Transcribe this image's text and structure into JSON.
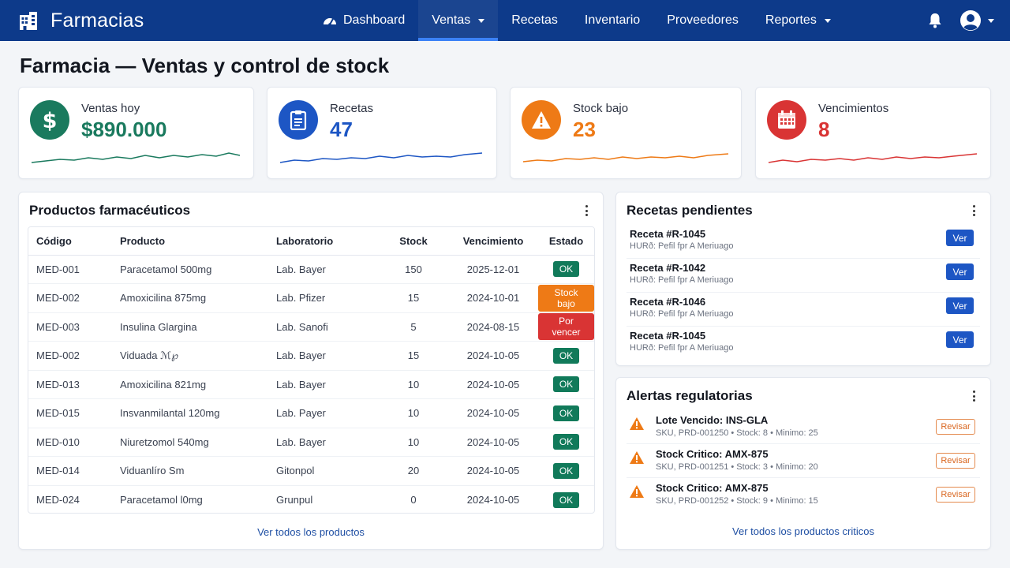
{
  "app": {
    "title": "Farmacias"
  },
  "nav": {
    "items": [
      {
        "label": "Dashboard",
        "icon": "gauge-icon"
      },
      {
        "label": "Ventas",
        "dropdown": true,
        "active": true
      },
      {
        "label": "Recetas"
      },
      {
        "label": "Inventario"
      },
      {
        "label": "Proveedores"
      },
      {
        "label": "Reportes",
        "dropdown": true
      }
    ]
  },
  "page": {
    "title": "Farmacia — Ventas y control de stock"
  },
  "kpis": [
    {
      "label": "Ventas hoy",
      "value": "$890.000",
      "icon": "dollar-icon",
      "color": "#1a7a5e"
    },
    {
      "label": "Recetas",
      "value": "47",
      "icon": "clipboard-icon",
      "color": "#1d56c4"
    },
    {
      "label": "Stock bajo",
      "value": "23",
      "icon": "warning-icon",
      "color": "#ee7a16"
    },
    {
      "label": "Vencimientos",
      "value": "8",
      "icon": "calendar-icon",
      "color": "#d93434"
    }
  ],
  "products": {
    "title": "Productos farmacéuticos",
    "columns": [
      "Código",
      "Producto",
      "Laboratorio",
      "Stock",
      "Vencimiento",
      "Estado"
    ],
    "rows": [
      {
        "code": "MED-001",
        "product": "Paracetamol 500mg",
        "lab": "Lab. Bayer",
        "stock": "150",
        "expiry": "2025-12-01",
        "status": "OK",
        "status_color": "#117a5a"
      },
      {
        "code": "MED-002",
        "product": "Amoxicilina 875mg",
        "lab": "Lab. Pfizer",
        "stock": "15",
        "expiry": "2024-10-01",
        "status": "Stock bajo",
        "status_color": "#ee7a16"
      },
      {
        "code": "MED-003",
        "product": "Insulina Glargina",
        "lab": "Lab. Sanofi",
        "stock": "5",
        "expiry": "2024-08-15",
        "status": "Por vencer",
        "status_color": "#d93434"
      },
      {
        "code": "MED-002",
        "product": "Viduada ℳ℘",
        "lab": "Lab. Bayer",
        "stock": "15",
        "expiry": "2024-10-05",
        "status": "OK",
        "status_color": "#117a5a"
      },
      {
        "code": "MED-013",
        "product": "Amoxicilina 821mg",
        "lab": "Lab. Bayer",
        "stock": "10",
        "expiry": "2024-10-05",
        "status": "OK",
        "status_color": "#117a5a"
      },
      {
        "code": "MED-015",
        "product": "Insvanmilantal 120mg",
        "lab": "Lab. Payer",
        "stock": "10",
        "expiry": "2024-10-05",
        "status": "OK",
        "status_color": "#117a5a"
      },
      {
        "code": "MED-010",
        "product": "Niuretzomol 540mg",
        "lab": "Lab. Bayer",
        "stock": "10",
        "expiry": "2024-10-05",
        "status": "OK",
        "status_color": "#117a5a"
      },
      {
        "code": "MED-014",
        "product": "Viduanlíro Sm",
        "lab": "Gitonpol",
        "stock": "20",
        "expiry": "2024-10-05",
        "status": "OK",
        "status_color": "#117a5a"
      },
      {
        "code": "MED-024",
        "product": "Paracetamol l0mg",
        "lab": "Grunpul",
        "stock": "0",
        "expiry": "2024-10-05",
        "status": "OK",
        "status_color": "#117a5a"
      }
    ],
    "footer_link": "Ver todos los productos"
  },
  "prescriptions": {
    "title": "Recetas pendientes",
    "button_label": "Ver",
    "items": [
      {
        "title": "Receta #R-1045",
        "subtitle": "HURð: Pefil fpr A Meriuago"
      },
      {
        "title": "Receta #R-1042",
        "subtitle": "HURð: Pefil fpr A Meriuago"
      },
      {
        "title": "Receta #R-1046",
        "subtitle": "HURð: Pefil fpr A Meriuago"
      },
      {
        "title": "Receta #R-1045",
        "subtitle": "HURð: Pefil fpr A Meriuago"
      }
    ]
  },
  "alerts": {
    "title": "Alertas regulatorias",
    "button_label": "Revisar",
    "items": [
      {
        "title": "Lote Vencido: INS-GLA",
        "subtitle": "SKU, PRD-001250  •  Stock: 8  •  Minimo: 25"
      },
      {
        "title": "Stock Critico: AMX-875",
        "subtitle": "SKU, PRD-001251  •  Stock: 3  •  Minimo: 20"
      },
      {
        "title": "Stock Critico: AMX-875",
        "subtitle": "SKU, PRD-001252  •  Stock: 9  •  Minimo: 15"
      }
    ],
    "footer_link": "Ver todos los productos criticos"
  }
}
